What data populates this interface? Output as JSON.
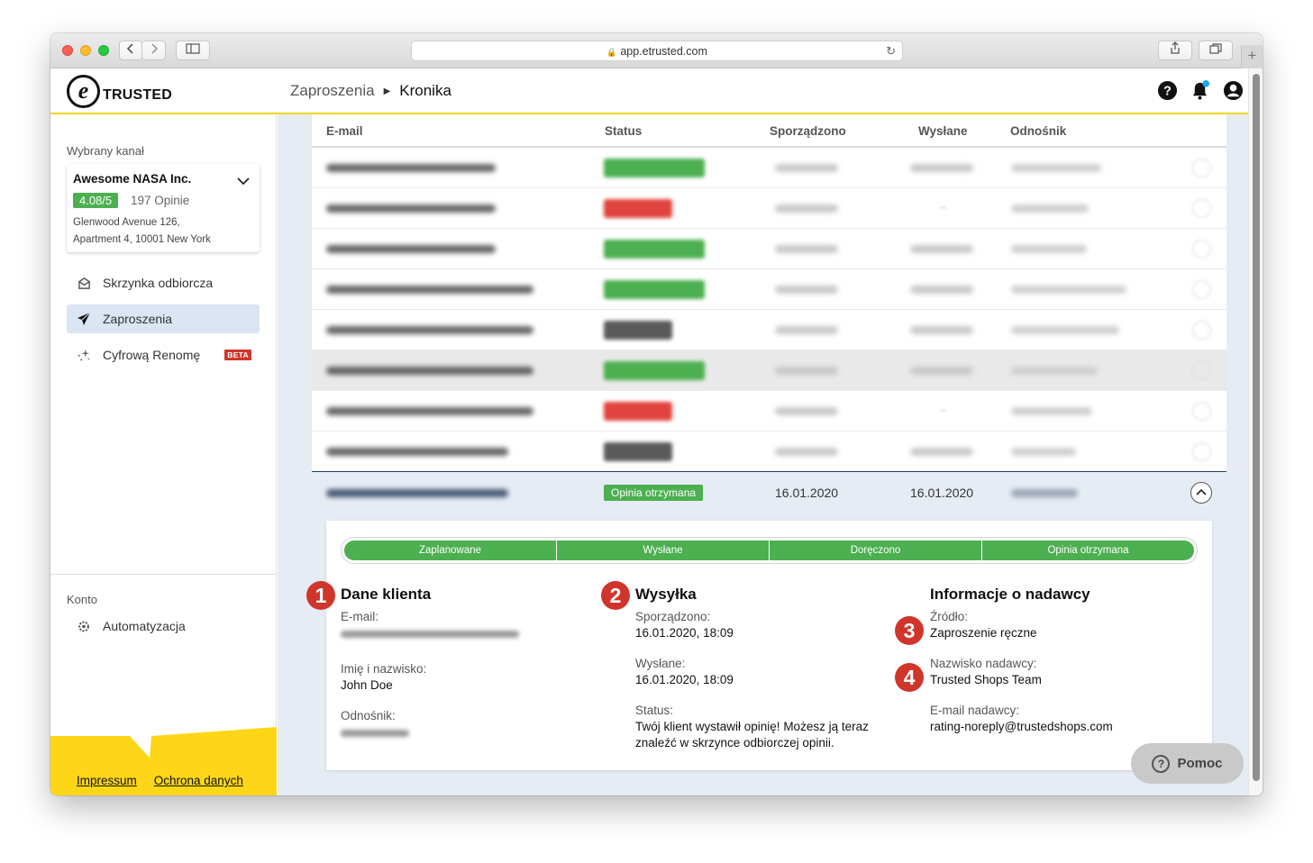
{
  "browser": {
    "url": "app.etrusted.com"
  },
  "header": {
    "logo_text": "TRUSTED",
    "breadcrumb": [
      "Zaproszenia",
      "Kronika"
    ]
  },
  "sidebar": {
    "channel_label": "Wybrany kanał",
    "channel": {
      "name": "Awesome NASA Inc.",
      "rating": "4.08/5",
      "reviews": "197 Opinie",
      "address_line1": "Glenwood Avenue 126,",
      "address_line2": "Apartment 4, 10001 New York"
    },
    "items": [
      {
        "label": "Skrzynka odbiorcza",
        "icon": "inbox-icon"
      },
      {
        "label": "Zaproszenia",
        "icon": "paper-plane-icon",
        "active": true
      },
      {
        "label": "Cyfrową Renomę",
        "icon": "sparkles-icon",
        "badge": "BETA"
      }
    ],
    "account_label": "Konto",
    "account_items": [
      {
        "label": "Automatyzacja",
        "icon": "automation-icon"
      }
    ],
    "footer_links": [
      "Impressum",
      "Ochrona danych"
    ]
  },
  "table": {
    "columns": [
      "E-mail",
      "Status",
      "Sporządzono",
      "Wysłane",
      "Odnośnik"
    ],
    "blurred_rows": [
      {
        "status_color": "#4caf50",
        "pill": "g",
        "sent": true
      },
      {
        "status_color": "#e0443e",
        "pill": "r",
        "sent": false
      },
      {
        "status_color": "#4caf50",
        "pill": "g",
        "sent": true
      },
      {
        "status_color": "#4caf50",
        "pill": "g",
        "sent": true
      },
      {
        "status_color": "#5a5a5a",
        "pill": "k",
        "sent": true
      },
      {
        "status_color": "#4caf50",
        "pill": "g",
        "sent": true,
        "hover": true
      },
      {
        "status_color": "#e0443e",
        "pill": "r",
        "sent": false
      },
      {
        "status_color": "#5a5a5a",
        "pill": "k",
        "sent": true
      }
    ],
    "expanded_row": {
      "status": "Opinia otrzymana",
      "created": "16.01.2020",
      "sent": "16.01.2020"
    }
  },
  "detail": {
    "steps": [
      "Zaplanowane",
      "Wysłane",
      "Doręczono",
      "Opinia otrzymana"
    ],
    "customer": {
      "marker": "1",
      "title": "Dane klienta",
      "email_label": "E-mail:",
      "name_label": "Imię i nazwisko:",
      "name_value": "John Doe",
      "ref_label": "Odnośnik:"
    },
    "shipping": {
      "marker": "2",
      "title": "Wysyłka",
      "created_label": "Sporządzono:",
      "created_value": "16.01.2020, 18:09",
      "sent_label": "Wysłane:",
      "sent_value": "16.01.2020, 18:09",
      "status_label": "Status:",
      "status_line1": "Twój klient wystawił opinię! Możesz ją teraz",
      "status_line2": "znaleźć w skrzynce odbiorczej opinii."
    },
    "sender": {
      "title": "Informacje o nadawcy",
      "source_marker": "3",
      "source_label": "Źródło:",
      "source_value": "Zaproszenie ręczne",
      "name_marker": "4",
      "name_label": "Nazwisko nadawcy:",
      "name_value": "Trusted Shops Team",
      "email_label": "E-mail nadawcy:",
      "email_value": "rating-noreply@trustedshops.com"
    }
  },
  "help_button": "Pomoc",
  "colors": {
    "accent_yellow": "#fdd617",
    "success": "#4caf50",
    "danger": "#d0352b",
    "active_nav": "#dbe5f3"
  }
}
